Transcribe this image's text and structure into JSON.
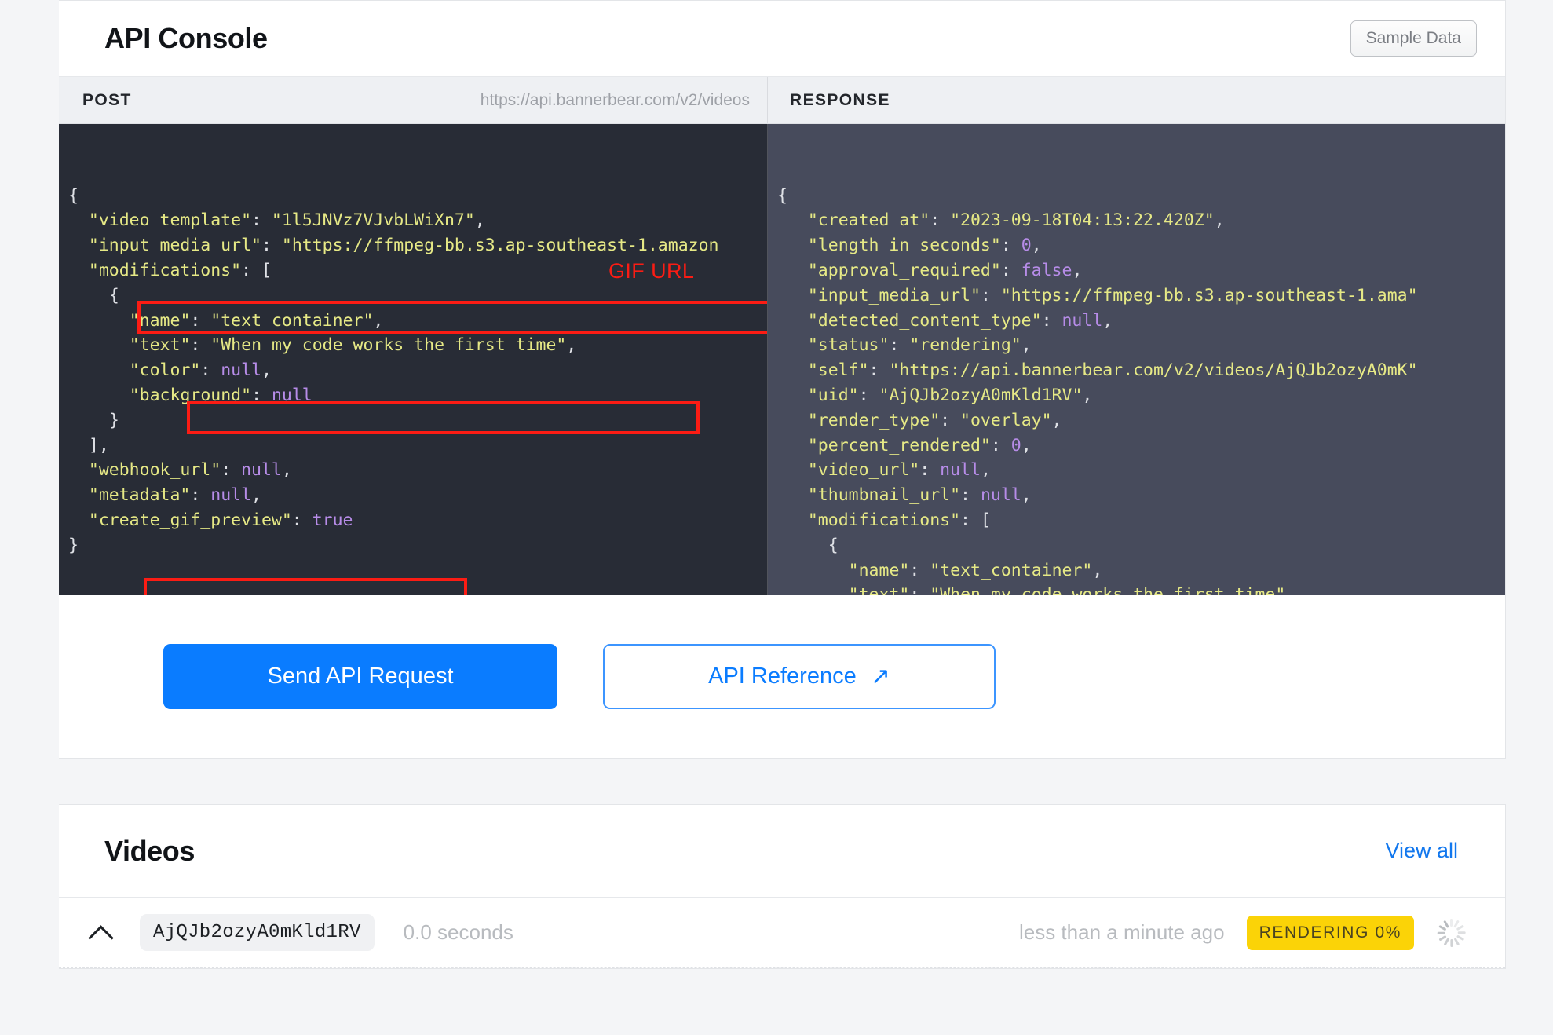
{
  "console": {
    "title": "API Console",
    "sample_data_label": "Sample Data",
    "method": "POST",
    "endpoint": "https://api.bannerbear.com/v2/videos",
    "response_label": "RESPONSE",
    "annotation_label": "GIF URL",
    "annotation_color": "#fb1c14",
    "accent_color": "#0a7cff"
  },
  "request_body": {
    "video_template": "1l5JNVz7VJvbLWiXn7",
    "input_media_url": "https://ffmpeg-bb.s3.ap-southeast-1.amazon",
    "modifications": [
      {
        "name": "text container",
        "text": "When my code works the first time",
        "color": null,
        "background": null
      }
    ],
    "webhook_url": null,
    "metadata": null,
    "create_gif_preview": true
  },
  "request_lines": [
    "{",
    "  \"video_template\": \"1l5JNVz7VJvbLWiXn7\",",
    "  \"input_media_url\": \"https://ffmpeg-bb.s3.ap-southeast-1.amazon",
    "  \"modifications\": [",
    "    {",
    "      \"name\": \"text container\",",
    "      \"text\": \"When my code works the first time\",",
    "      \"color\": null,",
    "      \"background\": null",
    "    }",
    "  ],",
    "  \"webhook_url\": null,",
    "  \"metadata\": null,",
    "  \"create_gif_preview\": true",
    "}"
  ],
  "response_body": {
    "created_at": "2023-09-18T04:13:22.420Z",
    "length_in_seconds": 0,
    "approval_required": false,
    "input_media_url": "https://ffmpeg-bb.s3.ap-southeast-1.ama",
    "detected_content_type": null,
    "status": "rendering",
    "self": "https://api.bannerbear.com/v2/videos/AjQJb2ozyA0mK",
    "uid": "AjQJb2ozyA0mKld1RV",
    "render_type": "overlay",
    "percent_rendered": 0,
    "video_url": null,
    "thumbnail_url": null,
    "modifications": [
      {
        "name": "text_container",
        "text": "When my code works the first time",
        "color": null,
        "background": null
      }
    ]
  },
  "buttons": {
    "send_label": "Send API Request",
    "reference_label": "API Reference",
    "reference_icon": "arrow-up-right-icon"
  },
  "videos": {
    "title": "Videos",
    "view_all_label": "View all",
    "rows": [
      {
        "uid": "AjQJb2ozyA0mKld1RV",
        "duration": "0.0 seconds",
        "timeago": "less than a minute ago",
        "status": "RENDERING 0%",
        "status_color": "#fbd307",
        "collapse_icon": "chevron-up-icon",
        "spinner_icon": "loading-spinner-icon"
      }
    ]
  }
}
